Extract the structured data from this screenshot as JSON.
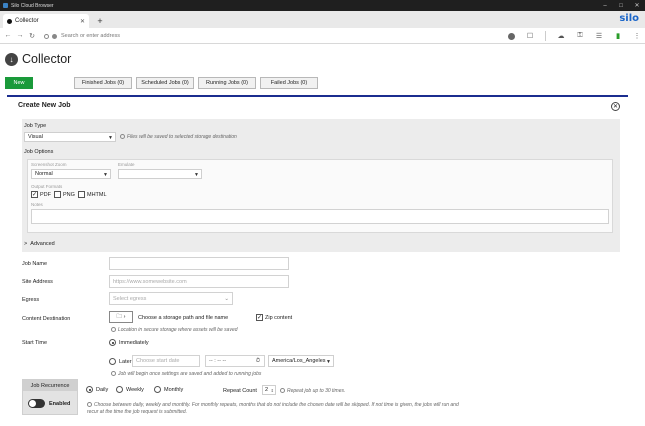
{
  "window": {
    "title": "Silo Cloud Browser",
    "brand": "silo"
  },
  "browser": {
    "tab_title": "Collector",
    "url_placeholder": "Search or enter address"
  },
  "page": {
    "title": "Collector",
    "new_button": "New",
    "job_tabs": [
      "Finished Jobs (0)",
      "Scheduled Jobs (0)",
      "Running Jobs (0)",
      "Failed Jobs (0)"
    ]
  },
  "form": {
    "title": "Create New Job",
    "job_type_label": "Job Type",
    "job_type_value": "Visual",
    "job_type_hint": "Files will be saved to selected storage destination",
    "job_options_label": "Job Options",
    "screenshot_zoom_label": "Screenshot Zoom",
    "screenshot_zoom_value": "Normal",
    "emulate_label": "Emulate",
    "emulate_value": "",
    "output_formats_label": "Output Formats",
    "formats": [
      {
        "label": "PDF",
        "checked": true
      },
      {
        "label": "PNG",
        "checked": false
      },
      {
        "label": "MHTML",
        "checked": false
      }
    ],
    "notes_label": "Notes",
    "advanced_label": "Advanced",
    "job_name_label": "Job Name",
    "site_address_label": "Site Address",
    "site_address_placeholder": "https://www.somewebsite.com",
    "egress_label": "Egress",
    "egress_placeholder": "Select egress",
    "content_dest_label": "Content Destination",
    "storage_button_text": "Choose a storage path and file name",
    "zip_label": "Zip content",
    "storage_hint": "Location in secure storage where assets will be saved",
    "start_time_label": "Start Time",
    "immediately_label": "Immediately",
    "later_label": "Later",
    "start_date_placeholder": "Choose start date",
    "time_placeholder": "-- : -- --",
    "timezone_value": "America/Los_Angeles",
    "start_hint": "Job will begin once settings are saved and added to running jobs",
    "job_recurrence_label": "Job Recurrence",
    "enabled_label": "Enabled",
    "recurrence_options": [
      "Daily",
      "Weekly",
      "Monthly"
    ],
    "repeat_count_label": "Repeat Count",
    "repeat_count_value": "2",
    "repeat_hint": "Repeat job up to 30 times.",
    "recurrence_hint_1": "Choose between daily, weekly and monthly. For monthly repeats, months that do not include the chosen date will be skipped. If not time is given, the jobs will run and",
    "recurrence_hint_2": "recur at the time the job request is submitted."
  }
}
